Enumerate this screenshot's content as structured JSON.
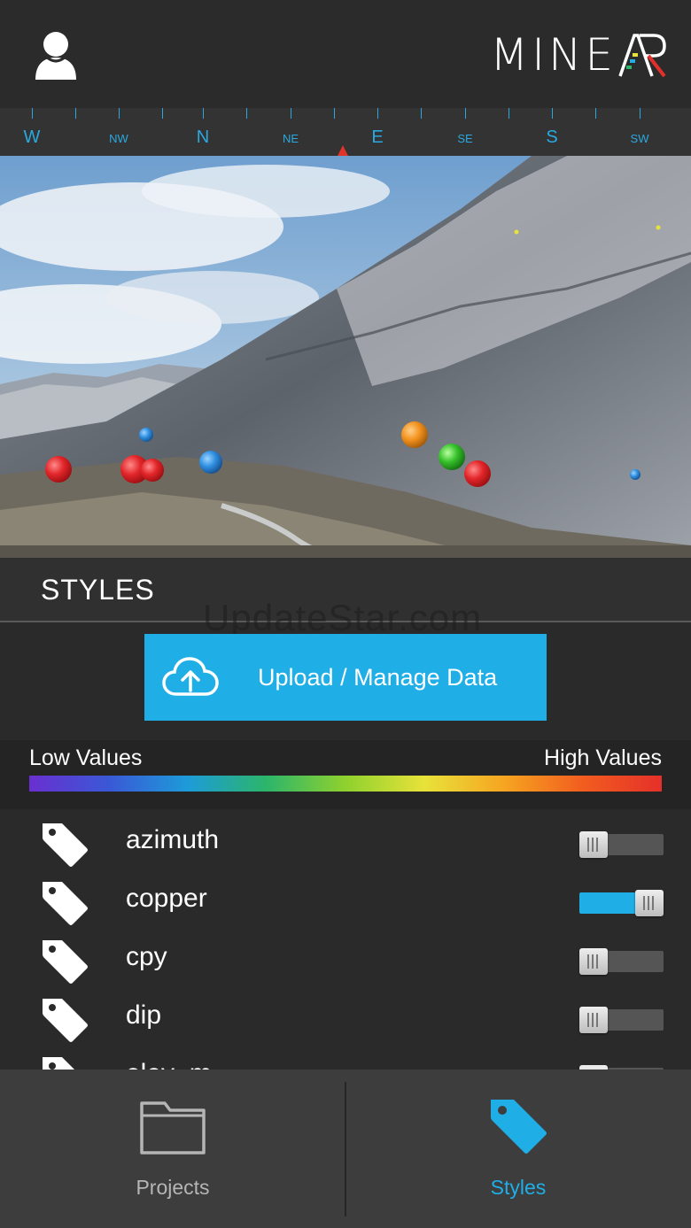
{
  "header": {
    "logo_text": "MINE",
    "logo_mark_letters": "AR",
    "user_icon": "user-icon"
  },
  "compass": {
    "labels": [
      "W",
      "NW",
      "N",
      "NE",
      "E",
      "SE",
      "S",
      "SW"
    ],
    "heading_marker_color": "#e0332a"
  },
  "styles_panel": {
    "title": "STYLES",
    "watermark": "UpdateStar.com",
    "upload_button_label": "Upload / Manage Data",
    "upload_icon": "cloud-upload-icon"
  },
  "legend": {
    "low_label": "Low Values",
    "high_label": "High Values",
    "gradient_colors": [
      "#6a2fd0",
      "#3a58d6",
      "#1d9bd9",
      "#2cb56a",
      "#8fd12e",
      "#e8e23a",
      "#f6a521",
      "#f25d1f",
      "#e5302a"
    ]
  },
  "attributes": [
    {
      "label": "azimuth",
      "enabled": false
    },
    {
      "label": "copper",
      "enabled": true
    },
    {
      "label": "cpy",
      "enabled": false
    },
    {
      "label": "dip",
      "enabled": false
    },
    {
      "label": "elev_m",
      "enabled": false
    }
  ],
  "tabs": [
    {
      "label": "Projects",
      "icon": "folder-icon",
      "active": false
    },
    {
      "label": "Styles",
      "icon": "tag-icon",
      "active": true
    }
  ],
  "colors": {
    "accent": "#1faee6",
    "inactive_tab": "#b5b5b5",
    "background": "#2a2a2a"
  }
}
